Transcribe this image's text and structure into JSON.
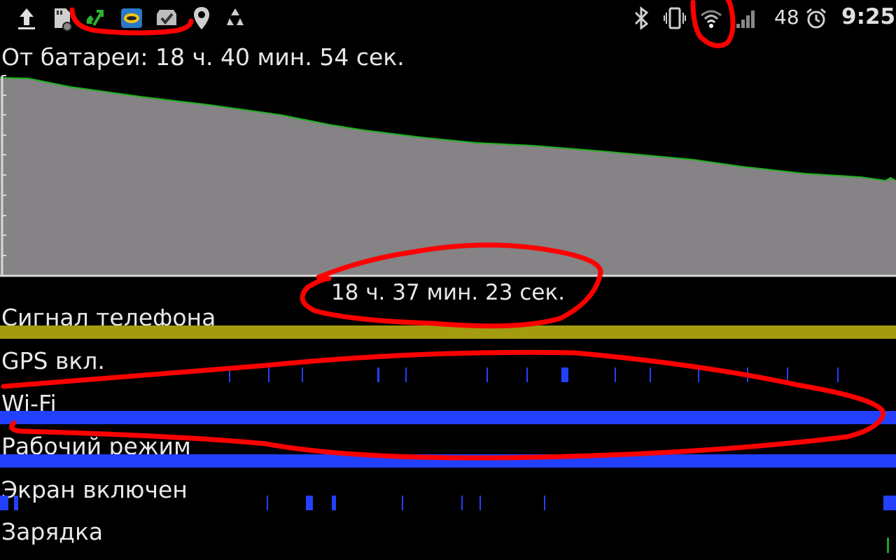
{
  "status_bar": {
    "left_icons": [
      "upload-icon",
      "sd-card-settings-icon",
      "missed-call-icon",
      "carrier-app-icon",
      "task-check-icon",
      "location-pin-icon",
      "recycle-icon"
    ],
    "right_icons": [
      "bluetooth-icon",
      "vibrate-icon",
      "wifi-signal-icon",
      "cell-signal-icon",
      "alarm-clock-icon"
    ],
    "battery_level": "48",
    "clock": "9:25"
  },
  "battery": {
    "time_on_battery": "От батареи: 18 ч. 40 мин. 54 сек.",
    "current_time": "18 ч. 37 мин. 23 сек.",
    "level_line_color": "#1db31d",
    "fill_color": "#858385"
  },
  "tracks": {
    "signal_label": "Сигнал телефона",
    "gps_label": "GPS вкл.",
    "wifi_label": "Wi-Fi",
    "awake_label": "Рабочий режим",
    "screen_label": "Экран включен",
    "charging_label": "Зарядка",
    "signal_color": "#a39b10",
    "active_color": "#2440ff",
    "charging_color": "#22a022"
  },
  "annotation_color": "#ff0000"
}
